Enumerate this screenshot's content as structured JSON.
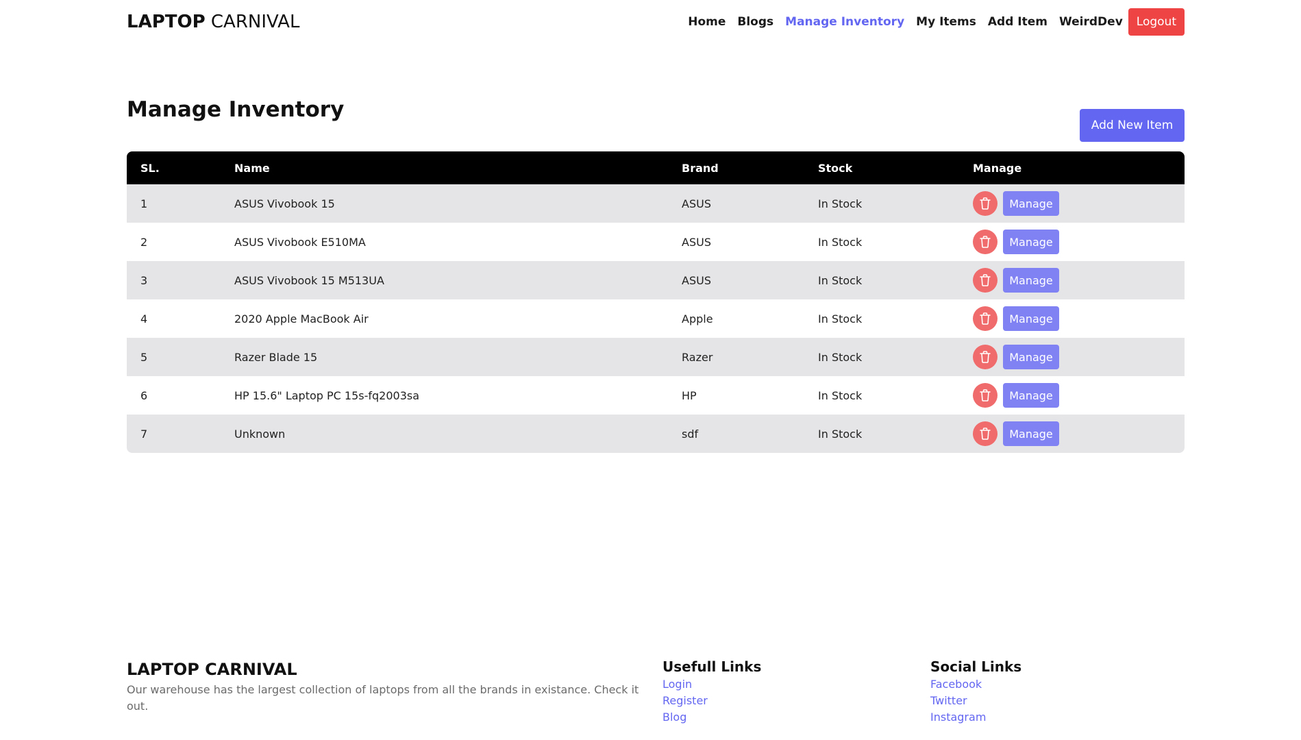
{
  "header": {
    "brand_strong": "LAPTOP",
    "brand_light": "CARNIVAL",
    "nav": [
      {
        "label": "Home"
      },
      {
        "label": "Blogs"
      },
      {
        "label": "Manage Inventory"
      },
      {
        "label": "My Items"
      },
      {
        "label": "Add Item"
      },
      {
        "label": "WeirdDev"
      }
    ],
    "logout_label": "Logout"
  },
  "colors": {
    "accent": "#6366f1",
    "danger": "#ef4444",
    "delete_circle": "#f06b6b",
    "manage_button": "#8082f4"
  },
  "main": {
    "title": "Manage Inventory",
    "add_new_label": "Add New Item",
    "table": {
      "headers": [
        "SL.",
        "Name",
        "Brand",
        "Stock",
        "Manage"
      ],
      "rows": [
        {
          "sl": "1",
          "name": "ASUS Vivobook 15",
          "brand": "ASUS",
          "stock": "In Stock",
          "delete_icon": "trash-icon",
          "manage_label": "Manage"
        },
        {
          "sl": "2",
          "name": "ASUS Vivobook E510MA",
          "brand": "ASUS",
          "stock": "In Stock",
          "delete_icon": "trash-icon",
          "manage_label": "Manage"
        },
        {
          "sl": "3",
          "name": "ASUS Vivobook 15 M513UA",
          "brand": "ASUS",
          "stock": "In Stock",
          "delete_icon": "trash-icon",
          "manage_label": "Manage"
        },
        {
          "sl": "4",
          "name": "2020 Apple MacBook Air",
          "brand": "Apple",
          "stock": "In Stock",
          "delete_icon": "trash-icon",
          "manage_label": "Manage"
        },
        {
          "sl": "5",
          "name": "Razer Blade 15",
          "brand": "Razer",
          "stock": "In Stock",
          "delete_icon": "trash-icon",
          "manage_label": "Manage"
        },
        {
          "sl": "6",
          "name": "HP 15.6\" Laptop PC 15s-fq2003sa",
          "brand": "HP",
          "stock": "In Stock",
          "delete_icon": "trash-icon",
          "manage_label": "Manage"
        },
        {
          "sl": "7",
          "name": "Unknown",
          "brand": "sdf",
          "stock": "In Stock",
          "delete_icon": "trash-icon",
          "manage_label": "Manage"
        }
      ]
    }
  },
  "footer": {
    "brand": "LAPTOP CARNIVAL",
    "description": "Our warehouse has the largest collection of laptops from all the brands in existance. Check it out.",
    "useful_heading": "Usefull Links",
    "useful_links": [
      {
        "label": "Login"
      },
      {
        "label": "Register"
      },
      {
        "label": "Blog"
      }
    ],
    "social_heading": "Social Links",
    "social_links": [
      {
        "label": "Facebook"
      },
      {
        "label": "Twitter"
      },
      {
        "label": "Instagram"
      }
    ]
  }
}
